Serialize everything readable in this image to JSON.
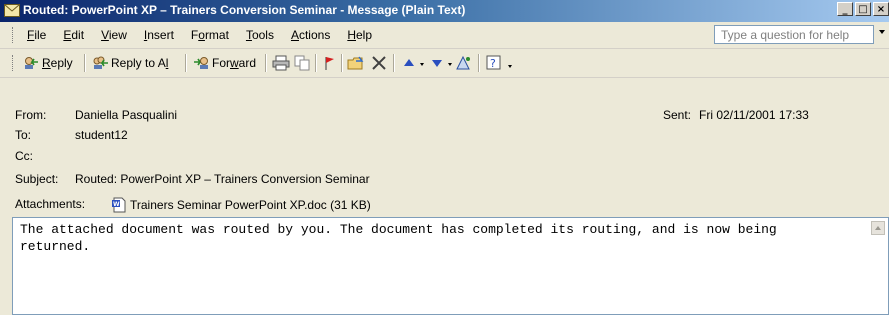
{
  "window": {
    "title": "Routed: PowerPoint XP – Trainers Conversion Seminar - Message (Plain Text)",
    "controls": {
      "minimize": "_",
      "maximize": "□",
      "close": "×"
    }
  },
  "menu": {
    "items": [
      {
        "key": "F",
        "rest": "ile"
      },
      {
        "key": "E",
        "rest": "dit"
      },
      {
        "key": "V",
        "rest": "iew"
      },
      {
        "key": "I",
        "rest": "nsert"
      },
      {
        "key": "",
        "pre": "F",
        "key2": "o",
        "rest": "rmat"
      },
      {
        "key": "T",
        "rest": "ools"
      },
      {
        "key": "A",
        "rest": "ctions"
      },
      {
        "key": "H",
        "rest": "elp"
      }
    ],
    "ask_placeholder": "Type a question for help"
  },
  "toolbar": {
    "reply_key": "R",
    "reply_rest": "eply",
    "reply_all_label": "Reply to A",
    "reply_all_key": "l",
    "reply_all_rest": "l",
    "forward_pre": "For",
    "forward_key": "w",
    "forward_rest": "ard"
  },
  "message": {
    "from_label": "From:",
    "from": "Daniella Pasqualini",
    "sent_label": "Sent:",
    "sent": "Fri 02/11/2001 17:33",
    "to_label": "To:",
    "to": "student12",
    "cc_label": "Cc:",
    "cc": "",
    "subject_label": "Subject:",
    "subject": "Routed: PowerPoint XP – Trainers Conversion Seminar",
    "attachments_label": "Attachments:",
    "attachment": "Trainers Seminar PowerPoint XP.doc (31 KB)",
    "body": "The attached document was routed by you. The document has completed its routing, and is now being returned."
  },
  "colors": {
    "titlebar": "#0a246a",
    "chrome": "#ece9d8",
    "border": "#7f9db9"
  }
}
